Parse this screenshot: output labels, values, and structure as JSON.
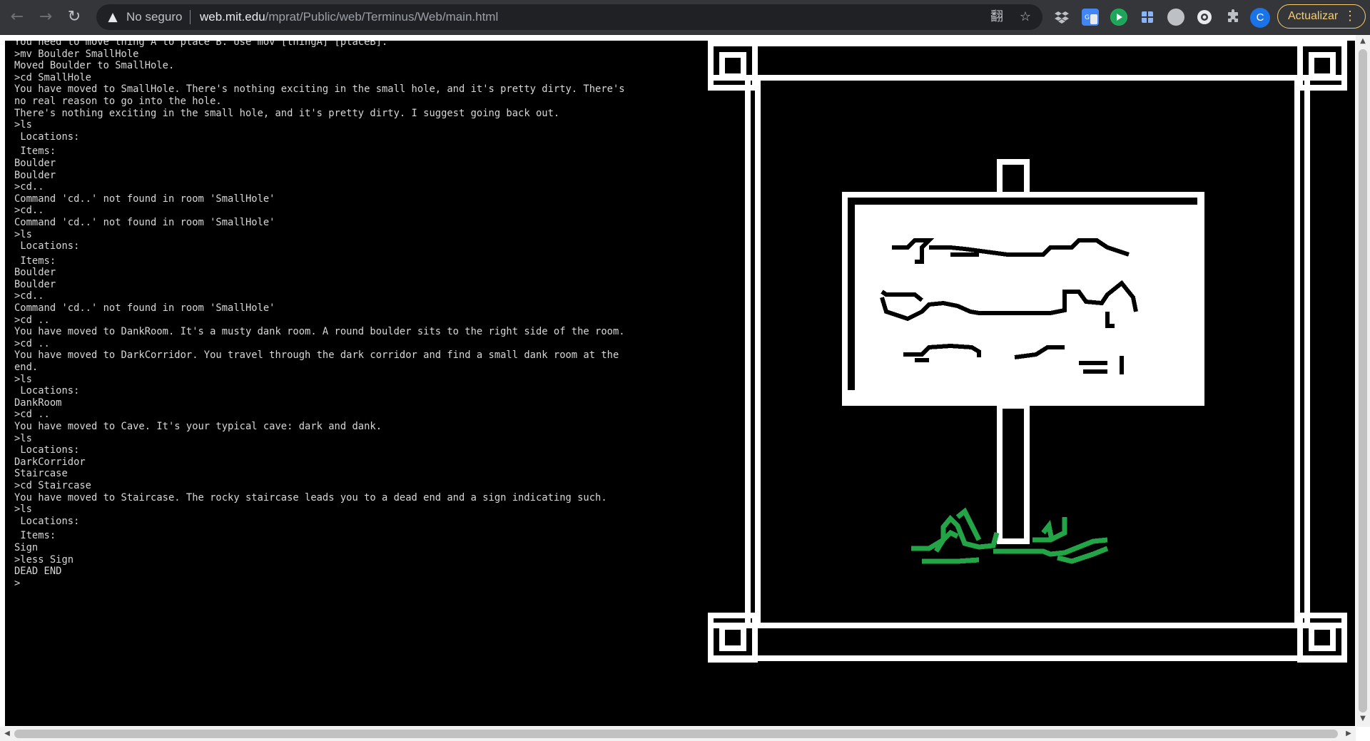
{
  "browser": {
    "security_label": "No seguro",
    "url_host": "web.mit.edu",
    "url_path": "/mprat/Public/web/Terminus/Web/main.html",
    "profile_initial": "C",
    "update_label": "Actualizar",
    "icons": {
      "back": "←",
      "forward": "→",
      "reload": "↻",
      "warning": "▲",
      "translate": "翻",
      "star": "☆",
      "menu": "⋮",
      "puzzle": "✱"
    }
  },
  "terminal": {
    "lines": [
      "You need to move thing A to place B. Use mov [thingA] [placeB].",
      ">mv Boulder SmallHole",
      "Moved Boulder to SmallHole.",
      ">cd SmallHole",
      "You have moved to SmallHole. There's nothing exciting in the small hole, and it's pretty dirty. There's no real reason to go into the hole.",
      "There's nothing exciting in the small hole, and it's pretty dirty. I suggest going back out.",
      ">ls",
      " Locations:",
      "",
      " Items:",
      "Boulder",
      "Boulder",
      ">cd..",
      "Command 'cd..' not found in room 'SmallHole'",
      ">cd..",
      "Command 'cd..' not found in room 'SmallHole'",
      ">ls",
      " Locations:",
      "",
      " Items:",
      "Boulder",
      "Boulder",
      ">cd..",
      "Command 'cd..' not found in room 'SmallHole'",
      ">cd ..",
      "You have moved to DankRoom. It's a musty dank room. A round boulder sits to the right side of the room.",
      ">cd ..",
      "You have moved to DarkCorridor. You travel through the dark corridor and find a small dank room at the end.",
      ">ls",
      " Locations:",
      "DankRoom",
      ">cd ..",
      "You have moved to Cave. It's your typical cave: dark and dank.",
      ">ls",
      " Locations:",
      "DarkCorridor",
      "Staircase",
      ">cd Staircase",
      "You have moved to Staircase. The rocky staircase leads you to a dead end and a sign indicating such.",
      ">ls",
      " Locations:",
      "",
      " Items:",
      "Sign",
      ">less Sign",
      "DEAD END",
      ">"
    ]
  },
  "colors": {
    "terminal_bg": "#000000",
    "terminal_text": "#d7d7d7",
    "grass": "#22a447",
    "update_accent": "#f9ce6b"
  }
}
